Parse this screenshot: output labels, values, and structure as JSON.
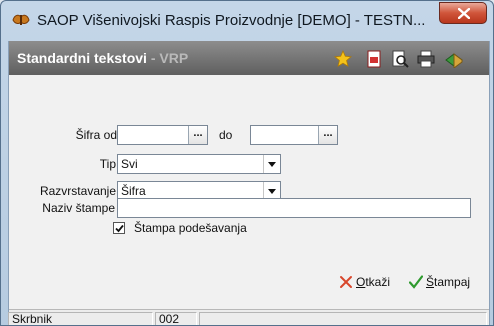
{
  "window": {
    "title": "SAOP Višenivojski Raspis Proizvodnje [DEMO] - TESTN..."
  },
  "header": {
    "title": "Standardni tekstovi",
    "subtitle": "- VRP"
  },
  "form": {
    "sifra_od_label": "Šifra od",
    "sifra_od_value": "",
    "do_label": "do",
    "do_value": "",
    "ellipsis": "...",
    "tip_label": "Tip",
    "tip_value": "Svi",
    "razvrstavanje_label": "Razvrstavanje",
    "razvrstavanje_value": "Šifra",
    "naziv_stampe_label": "Naziv štampe",
    "naziv_stampe_value": "",
    "stampa_podesavanja_label": "Štampa podešavanja",
    "stampa_podesavanja_checked": true
  },
  "buttons": {
    "otkazi_first": "O",
    "otkazi_rest": "tkaži",
    "stampaj_first": "Š",
    "stampaj_rest": "tampaj"
  },
  "status": {
    "user": "Skrbnik",
    "code": "002",
    "extra": ""
  },
  "colors": {
    "header_bg": "#5f5f5f",
    "cancel_icon": "#d8472c",
    "ok_icon": "#2e9a2e"
  }
}
